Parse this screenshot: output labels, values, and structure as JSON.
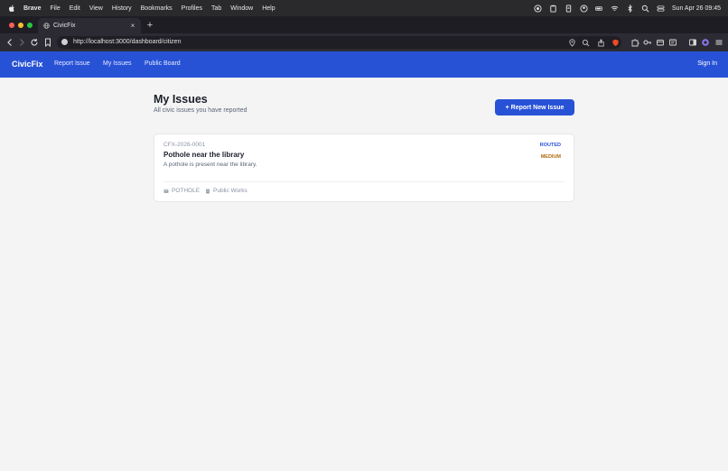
{
  "menubar": {
    "app_name": "Brave",
    "items": [
      "File",
      "Edit",
      "View",
      "History",
      "Bookmarks",
      "Profiles",
      "Tab",
      "Window",
      "Help"
    ],
    "clock": "Sun Apr 26  09:45"
  },
  "browser": {
    "tab_title": "CivicFix",
    "url": "http://localhost:3000/dashboard/citizen"
  },
  "nav": {
    "brand": "CivicFix",
    "links": [
      "Report Issue",
      "My Issues",
      "Public Board"
    ],
    "sign_in": "Sign In"
  },
  "page": {
    "title": "My Issues",
    "subtitle": "All civic issues you have reported",
    "report_button": "+ Report New Issue"
  },
  "issues": [
    {
      "ref": "CFX-2026-0001",
      "title": "Pothole near the library",
      "description": "A pothole is present near the library.",
      "status": "ROUTED",
      "priority": "MEDIUM",
      "category": "POTHOLE",
      "department": "Public Works"
    }
  ],
  "colors": {
    "brand_blue": "#2852d6",
    "priority_medium": "#b06a12",
    "page_bg": "#f4f4f4"
  }
}
